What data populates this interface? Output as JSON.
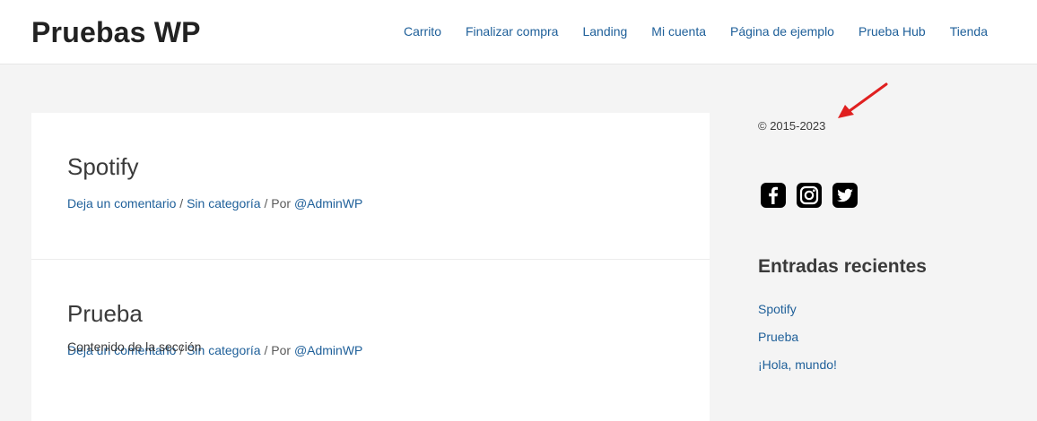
{
  "site": {
    "title": "Pruebas WP"
  },
  "nav": {
    "items": [
      {
        "label": "Carrito"
      },
      {
        "label": "Finalizar compra"
      },
      {
        "label": "Landing"
      },
      {
        "label": "Mi cuenta"
      },
      {
        "label": "Página de ejemplo"
      },
      {
        "label": "Prueba Hub"
      },
      {
        "label": "Tienda"
      }
    ]
  },
  "posts": [
    {
      "title": "Spotify",
      "meta": {
        "comments": "Deja un comentario",
        "sep1": " / ",
        "category": "Sin categoría",
        "sep2": " / Por ",
        "author": "@AdminWP"
      }
    },
    {
      "title": "Prueba",
      "meta": {
        "comments": "Deja un comentario",
        "sep1": " / ",
        "category": "Sin categoría",
        "sep2": " / Por ",
        "author": "@AdminWP"
      },
      "excerpt": "Contenido de la sección"
    }
  ],
  "sidebar": {
    "copyright": "© 2015-2023",
    "social_icons": [
      "facebook-icon",
      "instagram-icon",
      "twitter-icon"
    ],
    "recent_title": "Entradas recientes",
    "recent": [
      {
        "label": "Spotify"
      },
      {
        "label": "Prueba"
      },
      {
        "label": "¡Hola, mundo!"
      }
    ]
  },
  "colors": {
    "link": "#1e5f99",
    "arrow": "#e02020",
    "background": "#f4f4f4"
  }
}
